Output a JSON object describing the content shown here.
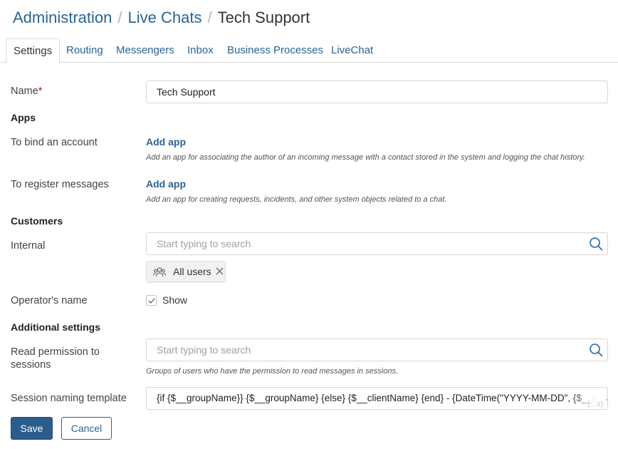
{
  "breadcrumb": {
    "items": [
      "Administration",
      "Live Chats",
      "Tech Support"
    ],
    "separator": "/"
  },
  "tabs": [
    {
      "label": "Settings",
      "active": true
    },
    {
      "label": "Routing"
    },
    {
      "label": "Messengers"
    },
    {
      "label": "Inbox"
    },
    {
      "label": "Business Processes"
    },
    {
      "label": "LiveChat"
    }
  ],
  "form": {
    "name": {
      "label": "Name",
      "required_mark": "*",
      "value": "Tech Support"
    },
    "apps": {
      "heading": "Apps",
      "bind_account": {
        "label": "To bind an account",
        "link": "Add app",
        "hint": "Add an app for associating the author of an incoming message with a contact stored in the system and logging the chat history."
      },
      "register_messages": {
        "label": "To register messages",
        "link": "Add app",
        "hint": "Add an app for creating requests, incidents, and other system objects related to a chat."
      }
    },
    "customers": {
      "heading": "Customers",
      "internal": {
        "label": "Internal",
        "placeholder": "Start typing to search",
        "chip": "All users",
        "chip_icon": "users-group-icon"
      },
      "operator_name": {
        "label": "Operator's name",
        "checkbox_label": "Show",
        "checked": true
      }
    },
    "additional": {
      "heading": "Additional settings",
      "read_permission": {
        "label_line1": "Read permission to",
        "label_line2": "sessions",
        "placeholder": "Start typing to search",
        "hint": "Groups of users who have the permission to read messages in sessions."
      },
      "session_template": {
        "label": "Session naming template",
        "value": "{if {$__groupName}} {$__groupName} {else} {$__clientName} {end} - {DateTime(\"YYYY-MM-DD\", {$__ses",
        "tag": "(...x)"
      }
    }
  },
  "buttons": {
    "save": "Save",
    "cancel": "Cancel"
  },
  "colors": {
    "link": "#2a6496",
    "primary_button": "#2a5d8a",
    "required": "#d0021b"
  }
}
